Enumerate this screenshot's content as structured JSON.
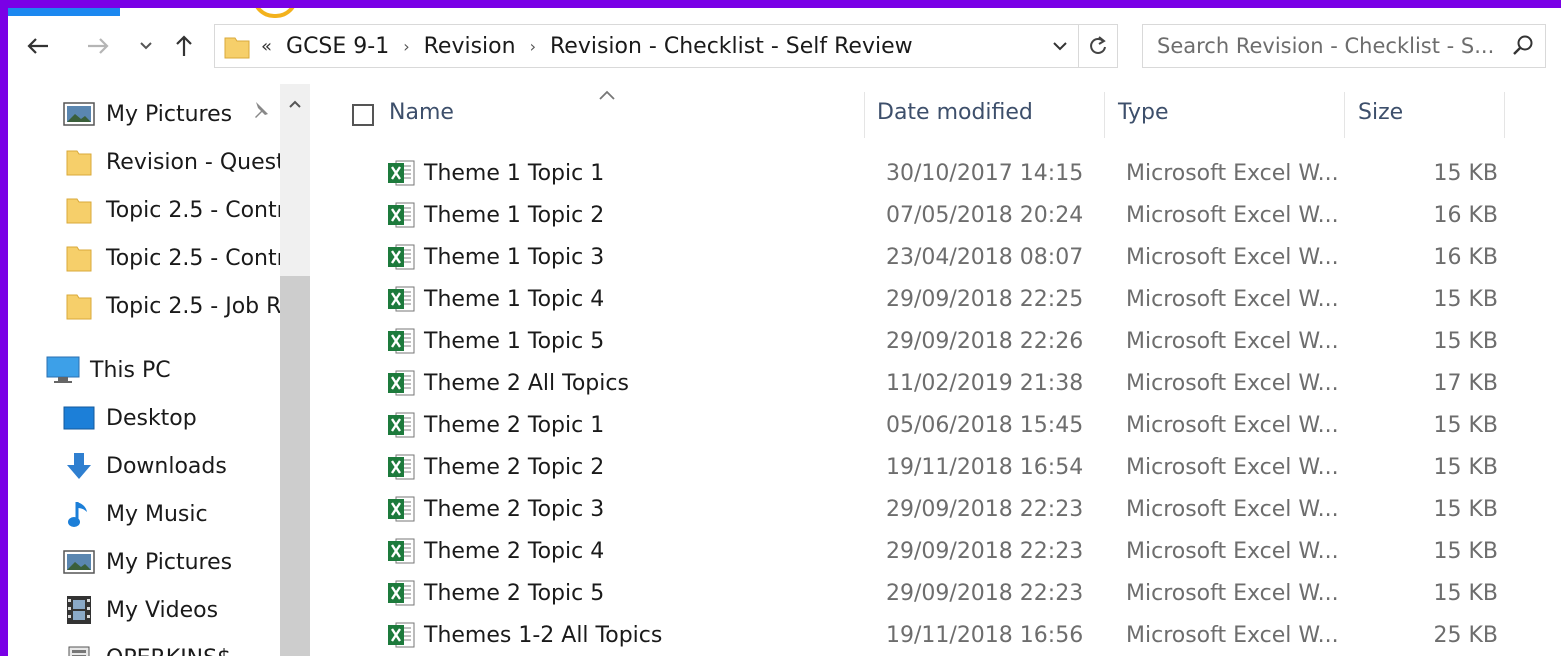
{
  "address": {
    "lead": "«",
    "crumbs": [
      "GCSE 9-1",
      "Revision",
      "Revision - Checklist - Self Review"
    ]
  },
  "search": {
    "placeholder": "Search Revision - Checklist - S..."
  },
  "nav": {
    "quick_access": [
      {
        "label": "My Pictures",
        "icon": "pictures-icon",
        "pinned": true
      },
      {
        "label": "Revision - Quest",
        "icon": "folder-icon"
      },
      {
        "label": "Topic 2.5 - Contr",
        "icon": "folder-icon"
      },
      {
        "label": "Topic 2.5 - Contr",
        "icon": "folder-icon"
      },
      {
        "label": "Topic 2.5 - Job R",
        "icon": "folder-icon"
      }
    ],
    "this_pc": "This PC",
    "pc_items": [
      {
        "label": "Desktop",
        "icon": "desktop-icon"
      },
      {
        "label": "Downloads",
        "icon": "downloads-icon"
      },
      {
        "label": "My Music",
        "icon": "music-icon"
      },
      {
        "label": "My Pictures",
        "icon": "pictures-icon"
      },
      {
        "label": "My Videos",
        "icon": "videos-icon"
      },
      {
        "label": "OPERKINS$",
        "icon": "network-drive-icon"
      }
    ]
  },
  "columns": {
    "name": "Name",
    "date": "Date modified",
    "type": "Type",
    "size": "Size"
  },
  "files": [
    {
      "name": "Theme 1 Topic 1",
      "date": "30/10/2017 14:15",
      "type": "Microsoft Excel W...",
      "size": "15 KB"
    },
    {
      "name": "Theme 1 Topic 2",
      "date": "07/05/2018 20:24",
      "type": "Microsoft Excel W...",
      "size": "16 KB"
    },
    {
      "name": "Theme 1 Topic 3",
      "date": "23/04/2018 08:07",
      "type": "Microsoft Excel W...",
      "size": "16 KB"
    },
    {
      "name": "Theme 1 Topic 4",
      "date": "29/09/2018 22:25",
      "type": "Microsoft Excel W...",
      "size": "15 KB"
    },
    {
      "name": "Theme 1 Topic 5",
      "date": "29/09/2018 22:26",
      "type": "Microsoft Excel W...",
      "size": "15 KB"
    },
    {
      "name": "Theme 2 All Topics",
      "date": "11/02/2019 21:38",
      "type": "Microsoft Excel W...",
      "size": "17 KB"
    },
    {
      "name": "Theme 2 Topic 1",
      "date": "05/06/2018 15:45",
      "type": "Microsoft Excel W...",
      "size": "15 KB"
    },
    {
      "name": "Theme 2 Topic 2",
      "date": "19/11/2018 16:54",
      "type": "Microsoft Excel W...",
      "size": "15 KB"
    },
    {
      "name": "Theme 2 Topic 3",
      "date": "29/09/2018 22:23",
      "type": "Microsoft Excel W...",
      "size": "15 KB"
    },
    {
      "name": "Theme 2 Topic 4",
      "date": "29/09/2018 22:23",
      "type": "Microsoft Excel W...",
      "size": "15 KB"
    },
    {
      "name": "Theme 2 Topic 5",
      "date": "29/09/2018 22:23",
      "type": "Microsoft Excel W...",
      "size": "15 KB"
    },
    {
      "name": "Themes 1-2 All Topics",
      "date": "19/11/2018 16:56",
      "type": "Microsoft Excel W...",
      "size": "25 KB"
    }
  ],
  "colors": {
    "background": "#7a00e6",
    "excel_green": "#1d7a3c",
    "folder": "#f6cf6a",
    "header_text": "#3d4f6b"
  }
}
